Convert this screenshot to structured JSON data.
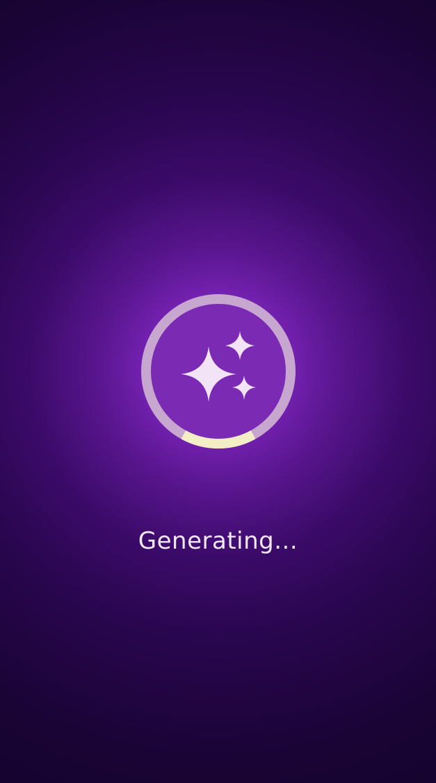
{
  "status": {
    "label": "Generating..."
  },
  "progress": {
    "fraction": 0.16
  },
  "icon": {
    "name": "sparkles-icon"
  },
  "colors": {
    "ring_track": "#c7a6cf",
    "ring_fill": "#f4eec6",
    "circle_fill": "#7b2ab3",
    "sparkle": "#f3e3f6",
    "text": "#f1e8f6"
  }
}
